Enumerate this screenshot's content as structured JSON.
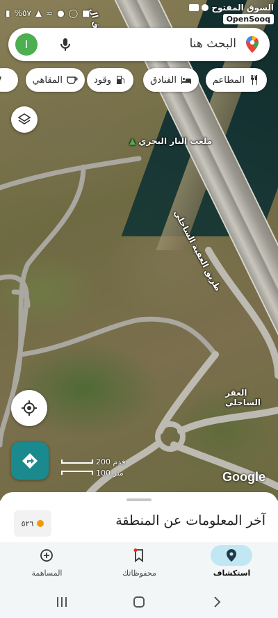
{
  "status_bar": {
    "time": "",
    "battery": "%٥٧"
  },
  "brand": {
    "arabic": "السوق المفتوح",
    "english": "OpenSooq"
  },
  "search": {
    "placeholder": "البحث هنا",
    "avatar_letter": "I"
  },
  "chips": [
    {
      "label": "المطاعم",
      "icon": "fork-knife-icon"
    },
    {
      "label": "الفنادق",
      "icon": "bed-icon"
    },
    {
      "label": "وقود",
      "icon": "gas-pump-icon"
    },
    {
      "label": "المقاهي",
      "icon": "coffee-cup-icon"
    }
  ],
  "map": {
    "place_labels": {
      "sports_field": "ملعب النار البحري",
      "coastal_road": "طريق العقبة الساحلي",
      "coastal_road_top": "طريق ال",
      "coastal_aqr": "العقر الساحلي"
    },
    "scale": {
      "feet": "200 قدم",
      "meters": "100 متر"
    },
    "attribution": "Google"
  },
  "sheet": {
    "title": "آخر المعلومات عن المنطقة",
    "aqi_value": "٥٢٦"
  },
  "bottom_nav": [
    {
      "label": "استكشاف",
      "icon": "location-pin-icon",
      "active": true
    },
    {
      "label": "محفوظاتك",
      "icon": "bookmark-icon",
      "active": false
    },
    {
      "label": "المساهمة",
      "icon": "add-circle-icon",
      "active": false
    }
  ],
  "colors": {
    "accent": "#1a8a8e",
    "active_nav": "#c2e7f4",
    "avatar": "#4caf50",
    "aqi": "#f29900"
  }
}
